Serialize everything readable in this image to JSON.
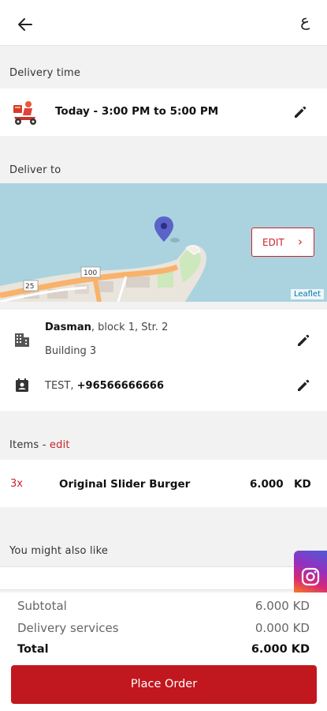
{
  "header": {
    "back_label": "←",
    "language_toggle": "ع"
  },
  "delivery": {
    "section_label": "Delivery time",
    "time_text": "Today - 3:00 PM to 5:00 PM"
  },
  "address": {
    "section_label": "Deliver to",
    "map_edit_label": "EDIT",
    "map_attribution": "Leaflet",
    "map_road_numbers": [
      "25",
      "100"
    ],
    "area": "Dasman",
    "area_rest": ", block 1, Str. 2",
    "building": "Building 3",
    "contact_name": "TEST, ",
    "contact_phone": "+96566666666"
  },
  "items": {
    "section_label": "Items - ",
    "edit_label": "edit",
    "list": [
      {
        "qty": "3x",
        "name": "Original Slider Burger",
        "price": "6.000",
        "currency": "KD"
      }
    ]
  },
  "suggestions": {
    "section_label": "You might also like"
  },
  "summary": {
    "subtotal_label": "Subtotal",
    "subtotal_value": "6.000 KD",
    "delivery_label": "Delivery services",
    "delivery_value": "0.000 KD",
    "total_label": "Total",
    "total_value": "6.000 KD"
  },
  "footer": {
    "place_order_label": "Place Order"
  },
  "colors": {
    "brand_red": "#c1171e",
    "accent_red": "#c9242b",
    "sea": "#aad3df",
    "pin": "#5b63c8"
  },
  "icons": [
    "back-arrow-icon",
    "language-icon",
    "scooter-icon",
    "pencil-icon",
    "map-pin-icon",
    "chevron-right-icon",
    "building-icon",
    "contact-card-icon",
    "instagram-icon"
  ]
}
